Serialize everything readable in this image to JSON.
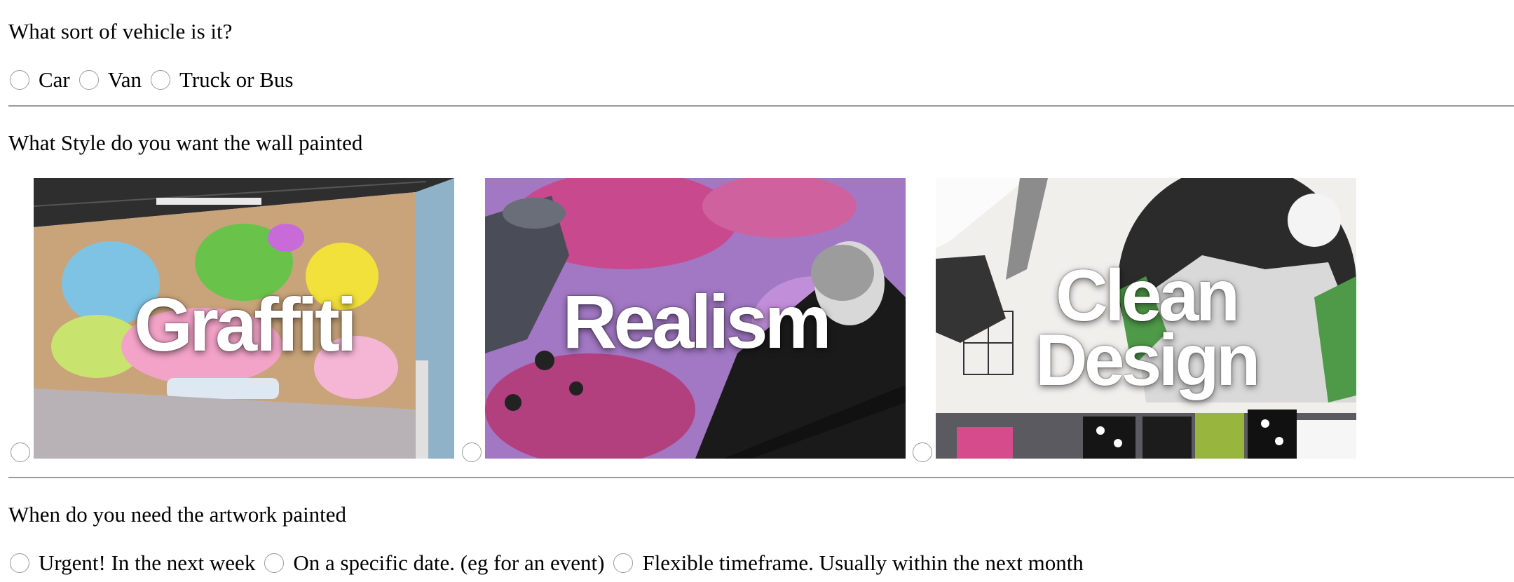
{
  "vehicle": {
    "question": "What sort of vehicle is it?",
    "options": [
      "Car",
      "Van",
      "Truck or Bus"
    ]
  },
  "style": {
    "question": "What Style do you want the wall painted",
    "options": [
      {
        "title": "Graffiti"
      },
      {
        "title": "Realism"
      },
      {
        "title_line1": "Clean",
        "title_line2": "Design"
      }
    ]
  },
  "timing": {
    "question": "When do you need the artwork painted",
    "options": [
      "Urgent! In the next week",
      "On a specific date. (eg for an event)",
      "Flexible timeframe. Usually within the next month"
    ]
  },
  "colors": {
    "text": "#000000",
    "radio_border": "#9a9a9a",
    "rule": "#9a9a9a",
    "overlay_text": "#ffffff"
  },
  "icons": {
    "radio": "radio-unselected-icon"
  }
}
